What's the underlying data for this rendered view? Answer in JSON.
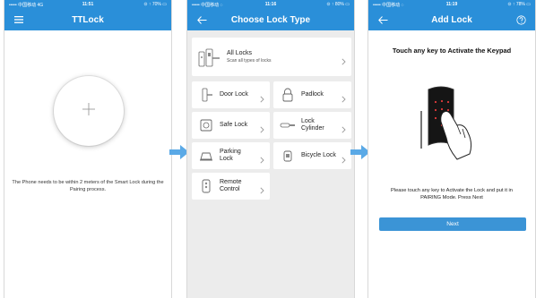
{
  "screen1": {
    "status": {
      "left": "••••• 中国移动 4G",
      "time": "11:51",
      "right": "⊙ ↑ 70% ▭"
    },
    "title": "TTLock",
    "pairing_note": "The Phone needs to be within 2 meters of the Smart Lock during the Pairing process."
  },
  "screen2": {
    "status": {
      "left": "••••• 中国移动 ◌",
      "time": "11:16",
      "right": "⊙ ↑ 80% ▭"
    },
    "title": "Choose Lock Type",
    "all_locks": {
      "label": "All Locks",
      "sub": "Scan all types of locks"
    },
    "types": [
      {
        "label": "Door Lock"
      },
      {
        "label": "Padlock"
      },
      {
        "label": "Safe Lock"
      },
      {
        "label": "Lock Cylinder"
      },
      {
        "label": "Parking Lock"
      },
      {
        "label": "Bicycle Lock"
      },
      {
        "label": "Remote Control"
      }
    ]
  },
  "screen3": {
    "status": {
      "left": "••••• 中国移动 ◌",
      "time": "11:19",
      "right": "⊙ ↑ 78% ▭"
    },
    "title": "Add Lock",
    "heading": "Touch any key to Activate the Keypad",
    "instruction": "Please touch any key to Activate the Lock and put it in PAIRING Mode. Press Next",
    "next_label": "Next"
  },
  "colors": {
    "primary": "#2a8fd9",
    "button": "#3b94d6",
    "arrow": "#5aa9e6"
  },
  "icons": [
    "menu-icon",
    "plus-icon",
    "back-arrow-icon",
    "help-icon",
    "chevron-right-icon",
    "keypad-illustration"
  ]
}
